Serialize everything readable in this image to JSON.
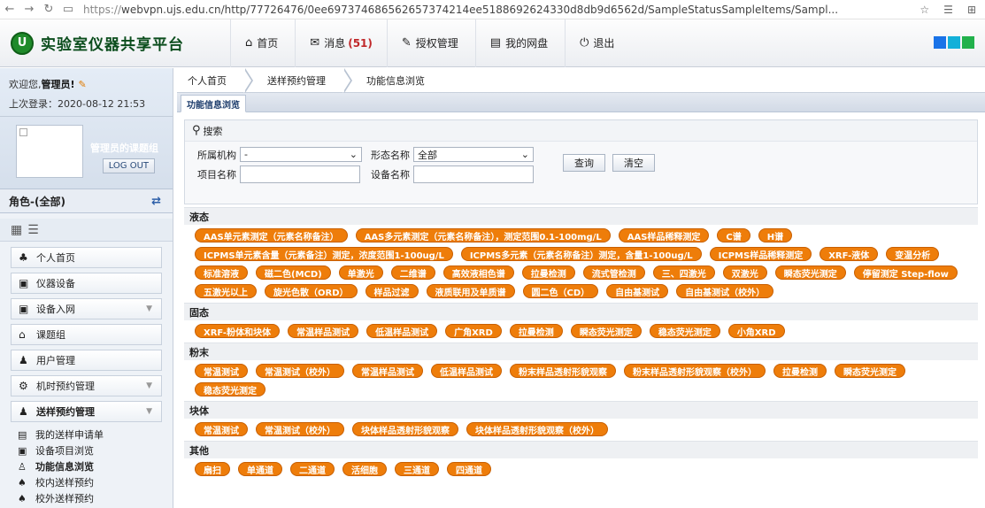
{
  "browser": {
    "back": "←",
    "forward": "→",
    "reload": "↻",
    "url_scheme": "https://",
    "url_rest": "webvpn.ujs.edu.cn/http/77726476/0ee697374686562657374214ee5188692624330d8db9d6562d/SampleStatusSampleItems/Sampl...",
    "icon_star": "☆",
    "icon_favlist": "☰",
    "icon_collections": "⊞"
  },
  "header": {
    "logo_text": "U",
    "title": "实验室仪器共享平台",
    "nav": [
      {
        "icon": "⌂",
        "label": "首页",
        "count": ""
      },
      {
        "icon": "✉",
        "label": "消息",
        "count": "(51)"
      },
      {
        "icon": "✎",
        "label": "授权管理",
        "count": ""
      },
      {
        "icon": "▤",
        "label": "我的网盘",
        "count": ""
      },
      {
        "icon": "⏻",
        "label": "退出",
        "count": ""
      }
    ],
    "theme_colors": [
      "#1a73e8",
      "#13b0d9",
      "#22b14c"
    ]
  },
  "sidebar": {
    "welcome_prefix": "欢迎您,",
    "welcome_user": "管理员!",
    "last_login": "上次登录：2020-08-12 21:53",
    "group_name": "管理员的课题组",
    "logout_label": "LOG OUT",
    "role_label": "角色-(全部)",
    "menu": [
      {
        "icon": "♣",
        "label": "个人首页",
        "arrow": ""
      },
      {
        "icon": "▣",
        "label": "仪器设备",
        "arrow": ""
      },
      {
        "icon": "▣",
        "label": "设备入网",
        "arrow": "▼"
      },
      {
        "icon": "⌂",
        "label": "课题组",
        "arrow": ""
      },
      {
        "icon": "♟",
        "label": "用户管理",
        "arrow": ""
      },
      {
        "icon": "⚙",
        "label": "机时预约管理",
        "arrow": "▼"
      },
      {
        "icon": "♟",
        "label": "送样预约管理",
        "arrow": "▼"
      }
    ],
    "submenu": [
      {
        "icon": "▤",
        "label": "我的送样申请单"
      },
      {
        "icon": "▣",
        "label": "设备项目浏览"
      },
      {
        "icon": "♙",
        "label": "功能信息浏览"
      },
      {
        "icon": "♠",
        "label": "校内送样预约"
      },
      {
        "icon": "♠",
        "label": "校外送样预约"
      }
    ]
  },
  "breadcrumb": [
    "个人首页",
    "送样预约管理",
    "功能信息浏览"
  ],
  "tab_label": "功能信息浏览",
  "search": {
    "title": "搜索",
    "org_label": "所属机构",
    "org_value": "-",
    "form_label": "形态名称",
    "form_value": "全部",
    "project_label": "项目名称",
    "device_label": "设备名称",
    "query_label": "查询",
    "clear_label": "清空"
  },
  "categories": [
    {
      "name": "液态",
      "items": [
        "AAS单元素测定（元素名称备注）",
        "AAS多元素测定（元素名称备注），测定范围0.1-100mg/L",
        "AAS样品稀释测定",
        "C谱",
        "H谱",
        "ICPMS单元素含量（元素备注）测定，浓度范围1-100ug/L",
        "ICPMS多元素（元素名称备注）测定，含量1-100ug/L",
        "ICPMS样品稀释测定",
        "XRF-液体",
        "变温分析",
        "标准溶液",
        "磁二色(MCD)",
        "单激光",
        "二维谱",
        "高效液相色谱",
        "拉曼检测",
        "流式管检测",
        "三、四激光",
        "双激光",
        "瞬态荧光测定",
        "停留测定 Step-flow",
        "五激光以上",
        "旋光色散（ORD）",
        "样品过滤",
        "液质联用及单质谱",
        "圆二色（CD）",
        "自由基测试",
        "自由基测试（校外）"
      ]
    },
    {
      "name": "固态",
      "items": [
        "XRF-粉体和块体",
        "常温样品测试",
        "低温样品测试",
        "广角XRD",
        "拉曼检测",
        "瞬态荧光测定",
        "稳态荧光测定",
        "小角XRD"
      ]
    },
    {
      "name": "粉末",
      "items": [
        "常温测试",
        "常温测试（校外）",
        "常温样品测试",
        "低温样品测试",
        "粉末样品透射形貌观察",
        "粉末样品透射形貌观察（校外）",
        "拉曼检测",
        "瞬态荧光测定",
        "稳态荧光测定"
      ]
    },
    {
      "name": "块体",
      "items": [
        "常温测试",
        "常温测试（校外）",
        "块体样品透射形貌观察",
        "块体样品透射形貌观察（校外）"
      ]
    },
    {
      "name": "其他",
      "items": [
        "扇扫",
        "单通道",
        "二通道",
        "活细胞",
        "三通道",
        "四通道"
      ]
    }
  ]
}
